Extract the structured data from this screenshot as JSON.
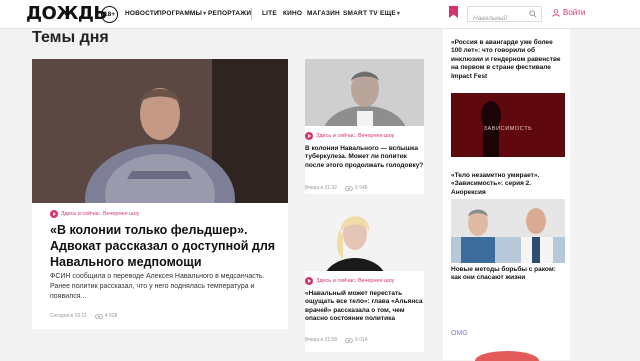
{
  "header": {
    "logo": "ДОЖДЬ",
    "age_badge": "18+",
    "nav": [
      "НОВОСТИ",
      "ПРОГРАММЫ",
      "РЕПОРТАЖИ"
    ],
    "nav2": [
      "LITE",
      "КИНО",
      "МАГАЗИН",
      "SMART TV",
      "ЕЩЕ"
    ],
    "search_placeholder": "Навальный",
    "login": "Войти",
    "accent": "#d7336b"
  },
  "main": {
    "section_title": "Темы дня",
    "big_card": {
      "tag": "Здесь и сейчас. Вечернее шоу",
      "headline": "«В колонии только фельдшер». Адвокат рассказал о доступной для Навального медпомощи",
      "lead": "ФСИН сообщила о переводе Алексея Навального в медсанчасть. Ранее политик рассказал, что у него поднялась температура и появился...",
      "time": "Сегодня в 03:11",
      "views": "4 928"
    },
    "small_card1": {
      "tag": "Здесь и сейчас. Вечернее шоу",
      "headline": "В колонии Навального — вспышка туберкулеза. Может ли политик после этого продолжать голодовку?",
      "time": "Вчера в 21:32",
      "views": "6 546"
    },
    "small_card2": {
      "tag": "Здесь и сейчас. Вечернее шоу",
      "headline": "«Навальный может перестать ощущать все тело»: глава «Альянса врачей» рассказала о том, чем опасно состояние политика",
      "time": "Вчера в 21:58",
      "views": "6 014"
    }
  },
  "sidebar": {
    "item1": "«Россия в авангарде уже более 100 лет»: что говорили об инклюзии и гендерном равенстве на первом в стране фестивале Impact Fest",
    "item2_image_text": "ЗАВИСИМОСТЬ",
    "item2": "«Тело незаметно умирает». «Зависимость»: серия 2. Анорексия",
    "item3": "Новые методы борьбы с раком: как они спасают жизни",
    "item4_label": "OMG"
  }
}
